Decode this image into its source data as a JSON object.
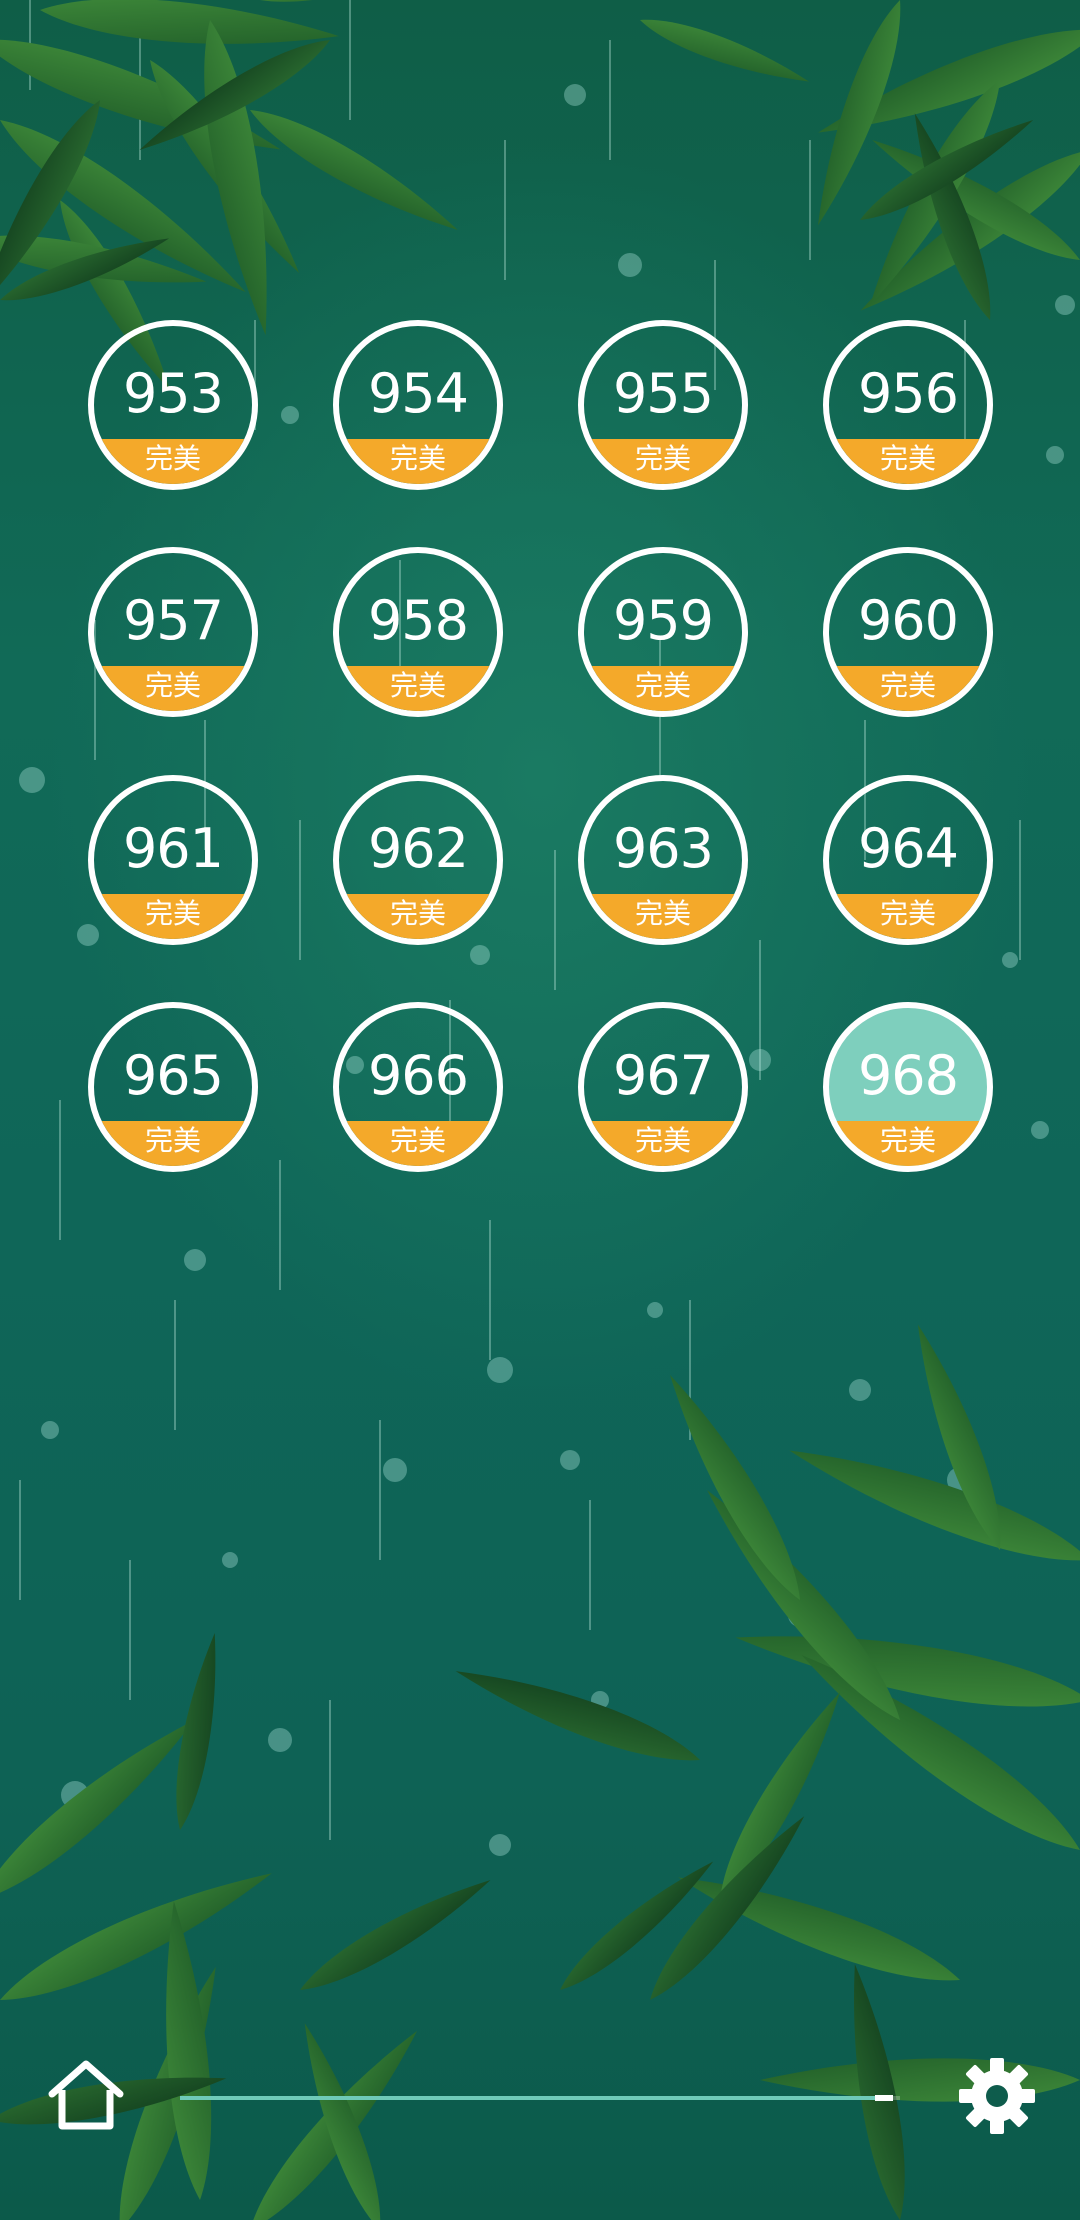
{
  "levels": [
    {
      "number": "953",
      "status": "完美",
      "current": false
    },
    {
      "number": "954",
      "status": "完美",
      "current": false
    },
    {
      "number": "955",
      "status": "完美",
      "current": false
    },
    {
      "number": "956",
      "status": "完美",
      "current": false
    },
    {
      "number": "957",
      "status": "完美",
      "current": false
    },
    {
      "number": "958",
      "status": "完美",
      "current": false
    },
    {
      "number": "959",
      "status": "完美",
      "current": false
    },
    {
      "number": "960",
      "status": "完美",
      "current": false
    },
    {
      "number": "961",
      "status": "完美",
      "current": false
    },
    {
      "number": "962",
      "status": "完美",
      "current": false
    },
    {
      "number": "963",
      "status": "完美",
      "current": false
    },
    {
      "number": "964",
      "status": "完美",
      "current": false
    },
    {
      "number": "965",
      "status": "完美",
      "current": false
    },
    {
      "number": "966",
      "status": "完美",
      "current": false
    },
    {
      "number": "967",
      "status": "完美",
      "current": false
    },
    {
      "number": "968",
      "status": "完美",
      "current": true
    }
  ],
  "navigation": {
    "home_icon": "home-icon",
    "settings_icon": "gear-icon",
    "progress_fraction": 0.99
  },
  "colors": {
    "badge": "#f4a92a",
    "ring": "#ffffff",
    "current_level_fill": "#7ecfbd",
    "background": "#0f6658"
  }
}
